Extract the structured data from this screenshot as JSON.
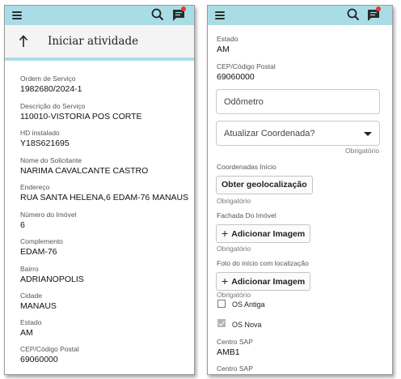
{
  "left": {
    "page_title": "Iniciar atividade",
    "fields": [
      {
        "label": "Ordem de Serviço",
        "value": "1982680/2024-1"
      },
      {
        "label": "Descrição do Serviço",
        "value": "110010-VISTORIA POS CORTE"
      },
      {
        "label": "HD instalado",
        "value": "Y18S621695"
      },
      {
        "label": "Nome do Solicitante",
        "value": "NARIMA CAVALCANTE CASTRO"
      },
      {
        "label": "Endereço",
        "value": "RUA SANTA HELENA,6 EDAM-76 MANAUS"
      },
      {
        "label": "Número do Imóvel",
        "value": "6"
      },
      {
        "label": "Complemento",
        "value": "EDAM-76"
      },
      {
        "label": "Bairro",
        "value": "ADRIANOPOLIS"
      },
      {
        "label": "Cidade",
        "value": "MANAUS"
      },
      {
        "label": "Estado",
        "value": "AM"
      },
      {
        "label": "CEP/Código Postal",
        "value": "69060000"
      }
    ]
  },
  "right": {
    "estado": {
      "label": "Estado",
      "value": "AM"
    },
    "cep": {
      "label": "CEP/Código Postal",
      "value": "69060000"
    },
    "odometro_placeholder": "Odômetro",
    "coordenada_select": "Atualizar Coordenada?",
    "required_text": "Obrigatório",
    "coordenadas_label": "Coordenadas Início",
    "geolocalizacao_button": "Obter geolocalização",
    "fachada_label": "Fachada Do Imóvel",
    "add_image_label": "Adicionar Imagem",
    "foto_label": "Foto do início com localização",
    "checkboxes": [
      {
        "label": "OS Antiga",
        "checked": false
      },
      {
        "label": "OS Nova",
        "checked": true
      }
    ],
    "centro_sap": {
      "label": "Centro SAP",
      "value": "AMB1"
    },
    "centro_sap_2_label": "Centro SAP"
  },
  "colors": {
    "header": "#a9dde6",
    "notification": "#e53935"
  }
}
